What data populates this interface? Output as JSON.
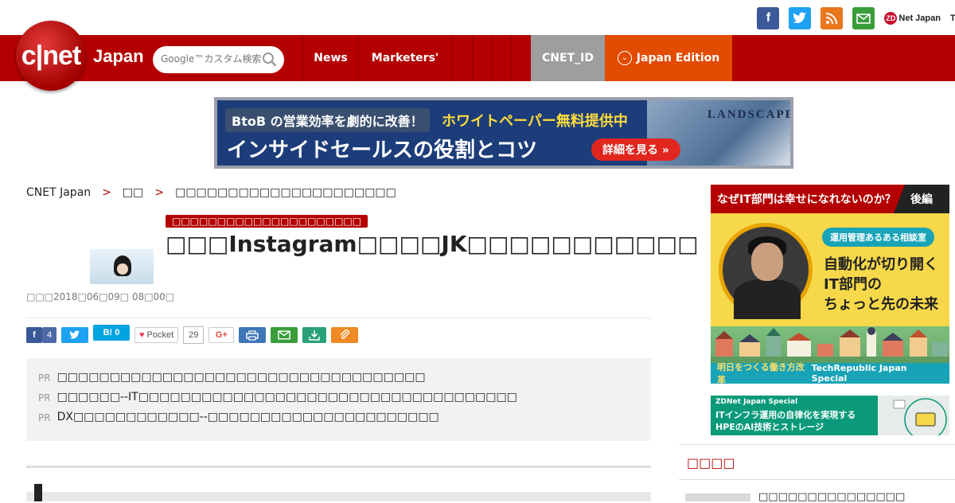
{
  "header": {
    "logo_text": "c|net",
    "logo_sub": "Japan",
    "search_placeholder": "Google™カスタム検索",
    "nav": [
      {
        "label": "News"
      },
      {
        "label": "Marketers'"
      },
      {
        "label": "CNET_ID"
      },
      {
        "label": "Japan Edition"
      }
    ],
    "social": {
      "facebook": "f",
      "twitter": "t",
      "rss": "rss",
      "mail": "mail",
      "zdnet": "Net Japan",
      "zdnet_mark": "ZD",
      "techrepublic": "Te"
    },
    "colors": {
      "brand_red": "#b40000",
      "edition_orange": "#e24c00",
      "id_grey": "#9e9e9e"
    }
  },
  "banner": {
    "tag": "BtoB の営業効率を劇的に改善！",
    "free": "ホワイトペーパー無料提供中",
    "main": "インサイドセールスの役割とコツ",
    "button": "詳細を見る »",
    "brand": "LANDSCAPE"
  },
  "breadcrumb": {
    "home": "CNET Japan",
    "sep": ">",
    "section": "□□",
    "current": "□□□□□□□□□□□□□□□□□□□□□"
  },
  "article": {
    "category": "□□□□□□□□□□□□□□□□□□□□□",
    "headline": "□□□Instagram□□□□JK□□□□□□□□□□□",
    "byline": "□□□2018□06□09□ 08□00□",
    "share": {
      "facebook_count": "4",
      "hatena": "B! 0",
      "pocket_label": "Pocket",
      "pocket_count": "29",
      "gplus": "G+"
    }
  },
  "pr": [
    {
      "label": "PR",
      "text": "□□□□□□□□□□□□□□□□□□□□□□□□□□□□□□□□□□□"
    },
    {
      "label": "PR",
      "text": "□□□□□□--IT□□□□□□□□□□□□□□□□□□□□□□□□□□□□□□□□□□□□"
    },
    {
      "label": "PR",
      "text": "DX□□□□□□□□□□□□--□□□□□□□□□□□□□□□□□□□□□□"
    }
  ],
  "sidebar": {
    "ad1": {
      "top": "なぜIT部門は幸せになれないのか？",
      "part": "後編",
      "pill": "運用管理あるある相談室",
      "lines": [
        "自動化が切り開く",
        "IT部門の",
        "ちょっと先の未来"
      ],
      "foot_left": "明日をつくる働き方改革",
      "foot_right": "TechRepublic Japan Special"
    },
    "ad2": {
      "label": "ZDNet Japan Special",
      "line1": "ITインフラ運用の自律化を実現する",
      "line2": "HPEのAI技術とストレージ"
    },
    "section_title": "□□□□",
    "item": "□□□□□□□□□□□□□□□"
  }
}
